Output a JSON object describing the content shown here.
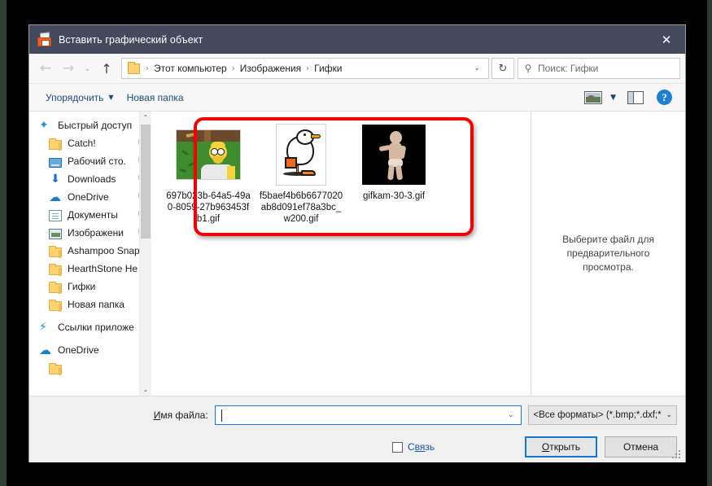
{
  "window": {
    "title": "Вставить графический объект",
    "icon": "insert-picture-icon",
    "close_label": "✕"
  },
  "nav": {
    "back_icon": "←",
    "forward_icon": "→",
    "history_icon": "⌄",
    "up_icon": "↑",
    "refresh_icon": "↻",
    "breadcrumb": [
      "Этот компьютер",
      "Изображения",
      "Гифки"
    ],
    "breadcrumb_separator": "›",
    "breadcrumb_caret": "⌄"
  },
  "search": {
    "icon": "search-icon",
    "placeholder": "Поиск: Гифки",
    "value": ""
  },
  "commandbar": {
    "organize_label": "Упорядочить",
    "organize_caret": "▼",
    "new_folder_label": "Новая папка",
    "view_icon": "view-options-icon",
    "view_caret": "▼",
    "preview_pane_icon": "preview-pane-icon",
    "help_icon": "?"
  },
  "sidebar": {
    "scroll_up_icon": "⌃",
    "scroll_down_icon": "⌄",
    "pin_icon": "📌",
    "items": [
      {
        "label": "Быстрый доступ",
        "icon": "star-icon",
        "indent": false,
        "pinned": false
      },
      {
        "label": "Catch!",
        "icon": "folder-icon",
        "indent": true,
        "pinned": true
      },
      {
        "label": "Рабочий сто.",
        "icon": "desktop-icon",
        "indent": true,
        "pinned": true
      },
      {
        "label": "Downloads",
        "icon": "download-icon",
        "indent": true,
        "pinned": true
      },
      {
        "label": "OneDrive",
        "icon": "cloud-icon",
        "indent": true,
        "pinned": true
      },
      {
        "label": "Документы",
        "icon": "document-icon",
        "indent": true,
        "pinned": true
      },
      {
        "label": "Изображени",
        "icon": "pictures-icon",
        "indent": true,
        "pinned": true
      },
      {
        "label": "Ashampoo Snap",
        "icon": "folder-icon",
        "indent": true,
        "pinned": false
      },
      {
        "label": "HearthStone  He",
        "icon": "folder-icon",
        "indent": true,
        "pinned": false
      },
      {
        "label": "Гифки",
        "icon": "folder-icon",
        "indent": true,
        "pinned": false
      },
      {
        "label": "Новая папка",
        "icon": "folder-icon",
        "indent": true,
        "pinned": false
      },
      {
        "label": "Ссылки приложе",
        "icon": "bolt-icon",
        "indent": false,
        "pinned": false
      },
      {
        "label": "OneDrive",
        "icon": "cloud-icon",
        "indent": false,
        "pinned": false
      }
    ]
  },
  "files": [
    {
      "name": "697b023b-64a5-49a0-8059-27b963453fb1.gif",
      "thumb": "homer-thumbnail"
    },
    {
      "name": "f5baef4b6b6677020ab8d091ef78a3bc_w200.gif",
      "thumb": "duck-thumbnail"
    },
    {
      "name": "gifkam-30-3.gif",
      "thumb": "dancing-baby-thumbnail"
    }
  ],
  "preview": {
    "message": "Выберите файл для предварительного просмотра."
  },
  "footer": {
    "filename_label": "Имя файла:",
    "filename_value": "",
    "filename_caret": "⌄",
    "filetype_value": "<Все форматы> (*.bmp;*.dxf;*",
    "filetype_caret": "⌄",
    "link_checkbox_label": "Связь",
    "link_checked": false,
    "open_button": "Открыть",
    "cancel_button": "Отмена"
  },
  "colors": {
    "titlebar": "#434a5e",
    "accent": "#1477d1",
    "annotation": "#f40000",
    "link_text": "#14539f",
    "folder": "#ffd271"
  }
}
